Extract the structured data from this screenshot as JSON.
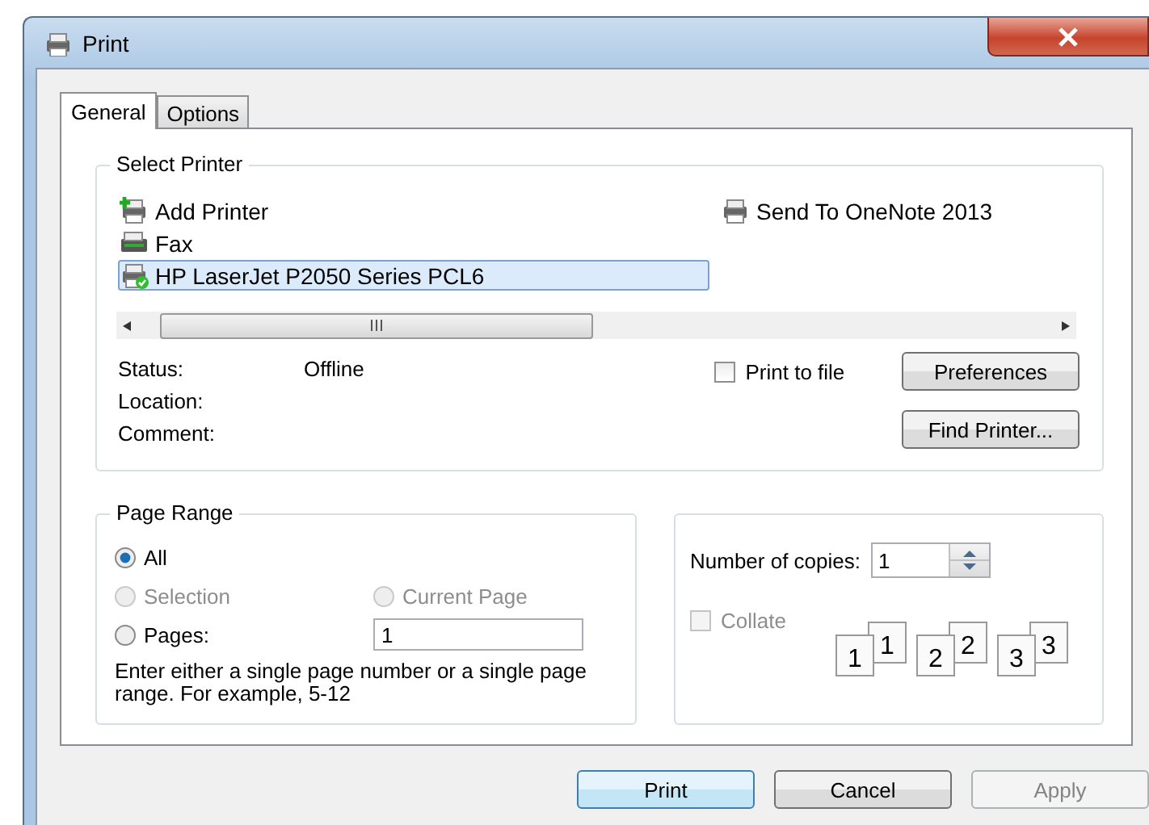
{
  "window": {
    "title": "Print"
  },
  "tabs": [
    {
      "label": "General",
      "selected": true
    },
    {
      "label": "Options",
      "selected": false
    }
  ],
  "select_printer": {
    "title": "Select Printer",
    "columns": [
      [
        {
          "name": "Add Printer",
          "kind": "add",
          "selected": false
        },
        {
          "name": "Fax",
          "kind": "fax",
          "selected": false
        },
        {
          "name": "HP LaserJet P2050 Series PCL6",
          "kind": "default",
          "selected": true
        }
      ],
      [
        {
          "name": "Send To OneNote 2013",
          "kind": "printer",
          "selected": false
        }
      ]
    ],
    "details": [
      {
        "label": "Status:",
        "value": "Offline"
      },
      {
        "label": "Location:"
      },
      {
        "label": "Comment:"
      }
    ],
    "print_to_file": {
      "label": "Print to file",
      "checked": false
    },
    "preferences_button": "Preferences",
    "find_printer_button": "Find Printer..."
  },
  "page_range": {
    "title": "Page Range",
    "options": [
      {
        "label": "All",
        "selected": true,
        "disabled": false
      },
      {
        "label": "Selection",
        "selected": false,
        "disabled": true
      },
      {
        "label": "Current Page",
        "selected": false,
        "disabled": true
      },
      {
        "label": "Pages:",
        "selected": false,
        "disabled": false
      }
    ],
    "pages_value": "1",
    "hint": "Enter either a single page number or a single page range.  For example, 5-12"
  },
  "copies": {
    "label": "Number of copies:",
    "value": "1",
    "collate": {
      "label": "Collate",
      "checked": false,
      "disabled": true
    },
    "collate_sets": [
      {
        "back": "1",
        "front": "1"
      },
      {
        "back": "2",
        "front": "2"
      },
      {
        "back": "3",
        "front": "3"
      }
    ]
  },
  "buttons": [
    {
      "label": "Print",
      "default": true,
      "disabled": false
    },
    {
      "label": "Cancel",
      "default": false,
      "disabled": false
    },
    {
      "label": "Apply",
      "default": false,
      "disabled": true
    }
  ]
}
